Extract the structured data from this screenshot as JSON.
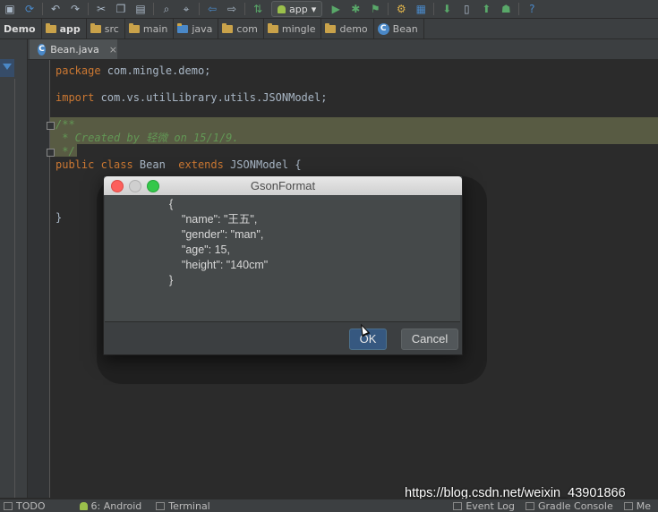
{
  "toolbar": {
    "run_config": "app"
  },
  "breadcrumb": {
    "items": [
      "Demo",
      "app",
      "src",
      "main",
      "java",
      "com",
      "mingle",
      "demo",
      "Bean"
    ]
  },
  "tab": {
    "label": "Bean.java",
    "close": "×"
  },
  "code": {
    "line1": "package com.mingle.demo;",
    "line2": "import com.vs.utilLibrary.utils.JSONModel;",
    "line3": "/**",
    "line4": " * Created by 轻微 on 15/1/9.",
    "line5": " */",
    "line6_kw1": "public class",
    "line6_name": " Bean  ",
    "line6_kw2": "extends",
    "line6_rest": " JSONModel {",
    "line7": "}",
    "kw_package": "package",
    "pkg_name": " com.mingle.demo;",
    "kw_import": "import",
    "import_name": " com.vs.utilLibrary.utils.JSONModel;"
  },
  "dialog": {
    "title": "GsonFormat",
    "json_lines": [
      "{",
      "    \"name\": \"王五\",",
      "    \"gender\": \"man\",",
      "    \"age\": 15,",
      "    \"height\": \"140cm\"",
      "}"
    ],
    "ok_label": "OK",
    "cancel_label": "Cancel"
  },
  "statusbar": {
    "todo": "TODO",
    "android": "6: Android",
    "terminal": "Terminal",
    "event_log": "Event Log",
    "gradle_console": "Gradle Console",
    "me": "Me"
  },
  "watermark": "https://blog.csdn.net/weixin_43901866",
  "colors": {
    "editor_bg": "#2b2b2b",
    "keyword": "#cc7832",
    "comment": "#629755",
    "ok_button": "#365880"
  }
}
